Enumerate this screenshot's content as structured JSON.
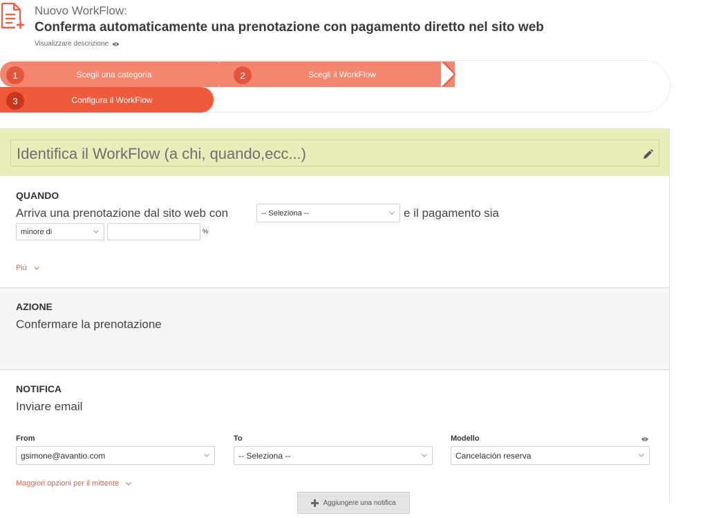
{
  "header": {
    "subtitle": "Nuovo WorkFlow:",
    "title": "Conferma automaticamente una prenotazione con pagamento diretto nel sito web",
    "description_link": "Visualizzare descrizione"
  },
  "steps": [
    {
      "number": "1",
      "label": "Scegli una categoria"
    },
    {
      "number": "2",
      "label": "Scegli il WorkFlow"
    },
    {
      "number": "3",
      "label": "Configura il WorkFlow"
    }
  ],
  "identify": {
    "placeholder": "Identifica il WorkFlow (a chi, quando,ecc...)"
  },
  "quando": {
    "title": "QUANDO",
    "text_before": "Arriva una prenotazione dal sito web con",
    "source_select": "-- Seleziona --",
    "text_after": "e il pagamento sia",
    "comparator_select": "minore di",
    "amount_value": "",
    "unit": "%",
    "more_link": "Più"
  },
  "azione": {
    "title": "AZIONE",
    "text": "Confermare la prenotazione"
  },
  "notifica": {
    "title": "NOTIFICA",
    "text": "Inviare email",
    "from_label": "From",
    "from_value": "gsimone@avantio.com",
    "to_label": "To",
    "to_value": "-- Seleziona --",
    "template_label": "Modello",
    "template_value": "Cancelación reserva",
    "more_sender_link": "Maggiori opzioni per il mittente"
  },
  "add_notification_button": "Aggiungere una notifica",
  "colors": {
    "accent": "#f05a3c",
    "step_light": "#f4866f",
    "identify_bg": "#e8edba",
    "link": "#e0654a"
  }
}
